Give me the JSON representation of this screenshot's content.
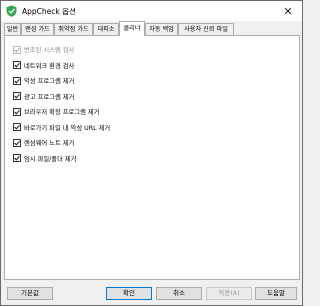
{
  "window": {
    "title": "AppCheck 옵션",
    "close_glyph": "✕",
    "accent_color": "#2fa84f"
  },
  "tabs": [
    {
      "label": "일반",
      "active": false
    },
    {
      "label": "랜섬 가드",
      "active": false
    },
    {
      "label": "취약점 가드",
      "active": false
    },
    {
      "label": "대피소",
      "active": false
    },
    {
      "label": "클리너",
      "active": true
    },
    {
      "label": "자동 백업",
      "active": false
    },
    {
      "label": "사용자 신뢰 파일",
      "active": false
    }
  ],
  "cleaner_options": [
    {
      "label": "번조된 시스템 검사",
      "checked": true,
      "enabled": false
    },
    {
      "label": "네트워크 환경 검사",
      "checked": true,
      "enabled": true
    },
    {
      "label": "악성 프로그램 제거",
      "checked": true,
      "enabled": true
    },
    {
      "label": "광고 프로그램 제거",
      "checked": true,
      "enabled": true
    },
    {
      "label": "브라우저 확장 프로그램 제거",
      "checked": true,
      "enabled": true
    },
    {
      "label": "바로가기 파일 내 악성 URL 제거",
      "checked": true,
      "enabled": true
    },
    {
      "label": "랜섬웨어 노트 제거",
      "checked": true,
      "enabled": true
    },
    {
      "label": "임시 파일/폴더 제거",
      "checked": true,
      "enabled": true
    }
  ],
  "buttons": {
    "defaults": "기본값",
    "ok": "확인",
    "cancel": "취소",
    "apply": "적용(A)",
    "help": "도움말"
  }
}
